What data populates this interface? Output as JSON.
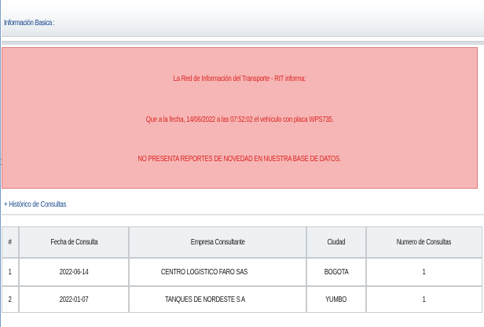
{
  "section": {
    "title": "Información Basica :"
  },
  "alert": {
    "line1": "La Red de Información del Transporte - RIT informa:",
    "line2": "Que a la fecha, 14/06/2022 a las 07:52:02 el vehículo con placa WPS735.",
    "line3": "NO PRESENTA REPORTES DE NOVEDAD EN NUESTRA BASE DE DATOS.",
    "background": "#f7b6b6",
    "text_color": "#d8241f"
  },
  "history": {
    "link_label": "+ Histórico de Consultas",
    "columns": [
      "#",
      "Fecha de Consulta",
      "Empresa Consultante",
      "Ciudad",
      "Numero de Consultas"
    ],
    "rows": [
      {
        "n": "1",
        "fecha": "2022-06-14",
        "empresa": "CENTRO LOGISTICO FARO SAS",
        "ciudad": "BOGOTA",
        "consultas": "1"
      },
      {
        "n": "2",
        "fecha": "2022-01-07",
        "empresa": "TANQUES DE NORDESTE S A",
        "ciudad": "YUMBO",
        "consultas": "1"
      }
    ]
  }
}
